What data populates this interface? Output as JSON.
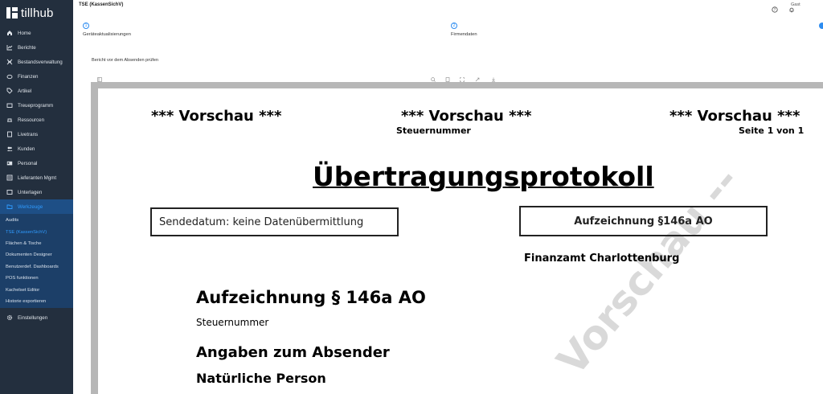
{
  "brand": {
    "name": "tillhub"
  },
  "sidebar": {
    "items": [
      {
        "label": "Home",
        "icon": "home-icon"
      },
      {
        "label": "Berichte",
        "icon": "chart-icon"
      },
      {
        "label": "Bestandsverwaltung",
        "icon": "inventory-icon"
      },
      {
        "label": "Finanzen",
        "icon": "piggy-bank-icon"
      },
      {
        "label": "Artikel",
        "icon": "tag-icon"
      },
      {
        "label": "Treueprogramm",
        "icon": "loyalty-card-icon"
      },
      {
        "label": "Ressourcen",
        "icon": "resources-icon"
      },
      {
        "label": "Livetrans",
        "icon": "receipt-icon"
      },
      {
        "label": "Kunden",
        "icon": "users-icon"
      },
      {
        "label": "Personal",
        "icon": "id-card-icon"
      },
      {
        "label": "Lieferanten Mgmt",
        "icon": "supplier-icon"
      },
      {
        "label": "Unterlagen",
        "icon": "documents-icon"
      },
      {
        "label": "Werkzeuge",
        "icon": "folder-icon",
        "active": true
      }
    ],
    "subitems": [
      {
        "label": "Audits"
      },
      {
        "label": "TSE (KassenSichV)",
        "active": true
      },
      {
        "label": "Flächen & Tische"
      },
      {
        "label": "Dokumenten Designer"
      },
      {
        "label": "Benutzerdef. Dashboards"
      },
      {
        "label": "POS funktionen"
      },
      {
        "label": "Kachelset Editor"
      },
      {
        "label": "Historie exportieren"
      }
    ],
    "settings": {
      "label": "Einstellungen",
      "icon": "gear-icon"
    }
  },
  "header": {
    "title": "TSE (KassenSichV)",
    "user": "Gast"
  },
  "stepper": {
    "steps": [
      {
        "num": "1",
        "label": "Geräteaktualisierungen"
      },
      {
        "num": "2",
        "label": "Firmendaten"
      }
    ]
  },
  "viewer": {
    "section_label": "Bericht vor dem Absenden prüfen"
  },
  "document": {
    "preview_left": "*** Vorschau ***",
    "preview_center": "*** Vorschau ***",
    "preview_right": "*** Vorschau ***",
    "tax_number_top": "Steuernummer",
    "page_info": "Seite 1 von 1",
    "title": "Übertragungsprotokoll",
    "send_date": "Sendedatum:  keine Datenübermittlung",
    "record_box": "Aufzeichnung §146a AO",
    "tax_office": "Finanzamt Charlottenburg",
    "record_heading": "Aufzeichnung § 146a AO",
    "tax_number": "Steuernummer",
    "sender_heading": "Angaben zum Absender",
    "natural_person": "Natürliche Person",
    "watermark": "Vorschau --"
  },
  "colors": {
    "sidebar_bg": "#232f3e",
    "active_bg": "#1e4f86",
    "accent": "#2d8cf0"
  }
}
